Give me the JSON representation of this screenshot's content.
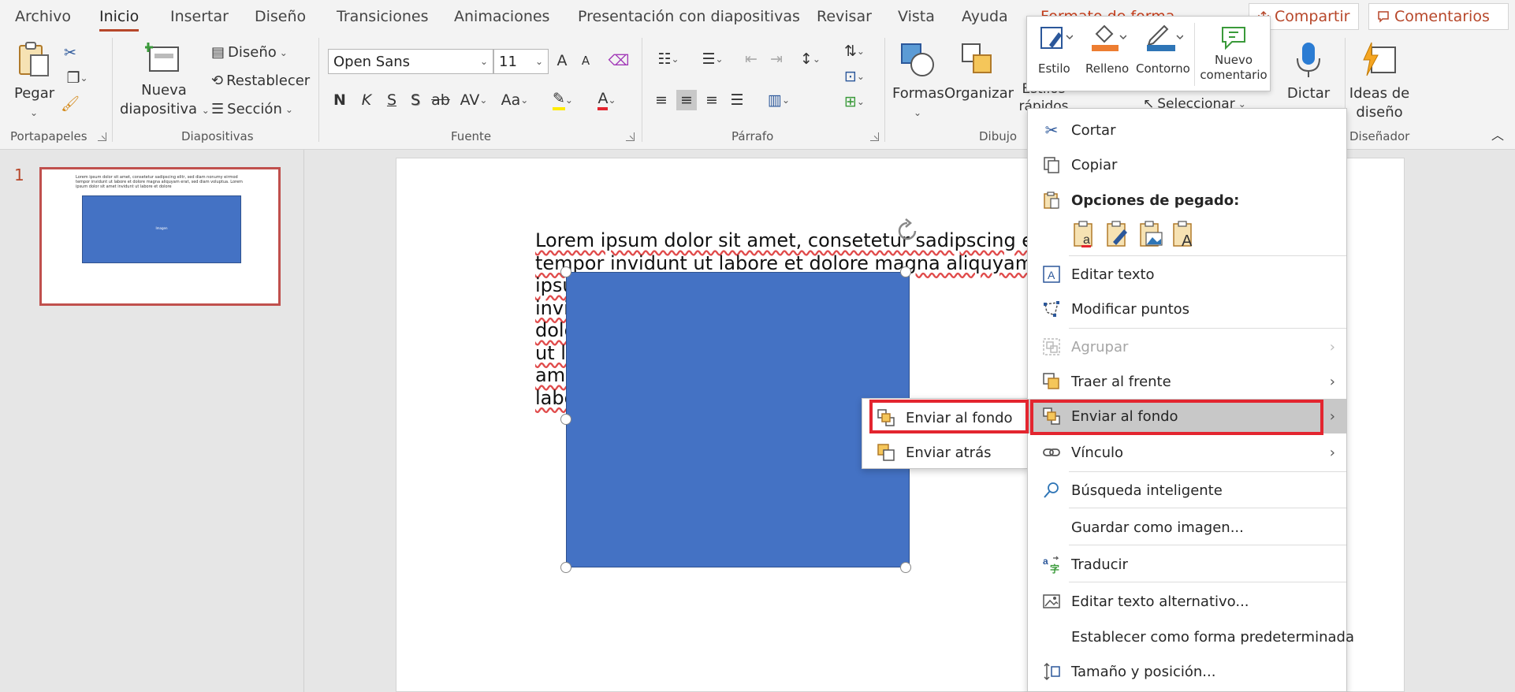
{
  "tabs": [
    {
      "label": "Archivo"
    },
    {
      "label": "Inicio"
    },
    {
      "label": "Insertar"
    },
    {
      "label": "Diseño"
    },
    {
      "label": "Transiciones"
    },
    {
      "label": "Animaciones"
    },
    {
      "label": "Presentación con diapositivas"
    },
    {
      "label": "Revisar"
    },
    {
      "label": "Vista"
    },
    {
      "label": "Ayuda"
    },
    {
      "label": "Formato de forma"
    }
  ],
  "share_label": "Compartir",
  "comments_label": "Comentarios",
  "ribbon": {
    "clipboard": {
      "paste": "Pegar",
      "group": "Portapapeles"
    },
    "slides": {
      "new_slide_line1": "Nueva",
      "new_slide_line2": "diapositiva",
      "layout": "Diseño",
      "reset": "Restablecer",
      "section": "Sección",
      "group": "Diapositivas"
    },
    "font": {
      "font_name": "Open Sans",
      "font_size": "11",
      "bold": "N",
      "italic": "K",
      "underline": "S",
      "shadow": "S",
      "strike": "ab",
      "spacing": "AV",
      "case": "Aa",
      "grow": "A",
      "shrink": "A",
      "group": "Fuente"
    },
    "paragraph": {
      "group": "Párrafo"
    },
    "drawing": {
      "shapes": "Formas",
      "arrange": "Organizar",
      "quick_styles_line1": "Estilos",
      "quick_styles_line2": "rápidos",
      "select": "Seleccionar",
      "group": "Dibujo"
    },
    "voice": {
      "dictate": "Dictar"
    },
    "designer": {
      "ideas_line1": "Ideas de",
      "ideas_line2": "diseño",
      "group": "Diseñador"
    }
  },
  "mini_toolbar": {
    "style": "Estilo",
    "fill": "Relleno",
    "outline": "Contorno",
    "new_comment_line1": "Nuevo",
    "new_comment_line2": "comentario"
  },
  "thumbnail": {
    "number": "1",
    "text": "Lorem ipsum dolor sit amet, consetetur sadipscing elitr, sed diam nonumy eirmod tempor invidunt ut labore et dolore magna aliquyam erat, sed diam voluptua. Lorem ipsum dolor sit amet invidunt ut labore et dolore",
    "shape_label": "Imagen"
  },
  "slide": {
    "line1": "Lorem ipsum dolor sit amet, consetetur sadipscing elitr,",
    "line2": "tempor invidunt ut labore et dolore magna aliquyam era",
    "line3": "ipsu",
    "line4": "invi",
    "line5": "dolo",
    "line6": "ut la",
    "line7": "ame",
    "line8": "labo"
  },
  "context_menu": {
    "cut": "Cortar",
    "copy": "Copiar",
    "paste_options": "Opciones de pegado:",
    "edit_text": "Editar texto",
    "edit_points": "Modificar puntos",
    "group": "Agrupar",
    "bring_front": "Traer al frente",
    "send_back": "Enviar al fondo",
    "link": "Vínculo",
    "smart_lookup": "Búsqueda inteligente",
    "save_as_picture": "Guardar como imagen...",
    "translate": "Traducir",
    "alt_text": "Editar texto alternativo...",
    "set_default": "Establecer como forma predeterminada",
    "size_position": "Tamaño y posición..."
  },
  "submenu": {
    "send_to_back": "Enviar al fondo",
    "send_backward": "Enviar atrás"
  },
  "colors": {
    "accent": "#b7472a",
    "shape_fill": "#4472c4",
    "highlight": "#e3252f"
  }
}
